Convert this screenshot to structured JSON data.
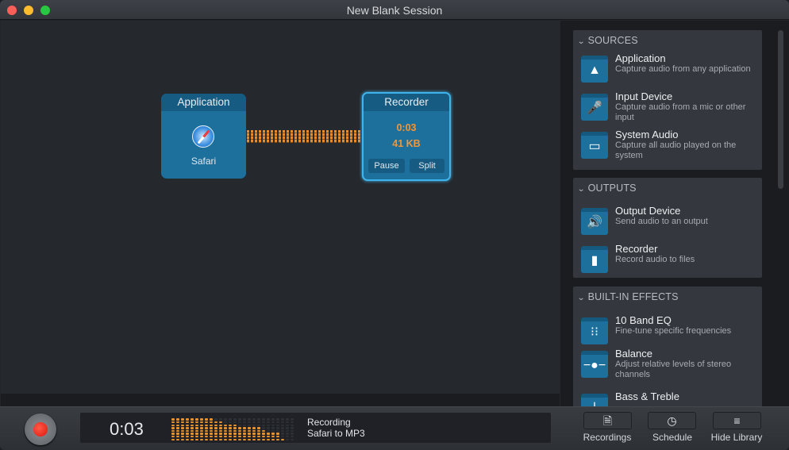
{
  "window": {
    "title": "New Blank Session",
    "controls": [
      "close",
      "minimize",
      "maximize"
    ]
  },
  "canvas": {
    "application_block": {
      "header": "Application",
      "icon": "safari-compass-icon",
      "label": "Safari"
    },
    "recorder_block": {
      "header": "Recorder",
      "time": "0:03",
      "size": "41 KB",
      "pause_label": "Pause",
      "split_label": "Split",
      "selected": true
    },
    "accent_color": "#f0973a"
  },
  "library": {
    "sections": [
      {
        "title": "SOURCES",
        "items": [
          {
            "title": "Application",
            "description": "Capture audio from any application",
            "icon": "app-store-icon"
          },
          {
            "title": "Input Device",
            "description": "Capture audio from a mic or other input",
            "icon": "microphone-icon"
          },
          {
            "title": "System Audio",
            "description": "Capture all audio played on the system",
            "icon": "monitor-icon"
          }
        ]
      },
      {
        "title": "OUTPUTS",
        "items": [
          {
            "title": "Output Device",
            "description": "Send audio to an output",
            "icon": "speaker-icon"
          },
          {
            "title": "Recorder",
            "description": "Record audio to files",
            "icon": "document-icon"
          }
        ]
      },
      {
        "title": "BUILT-IN EFFECTS",
        "items": [
          {
            "title": "10 Band EQ",
            "description": "Fine-tune specific frequencies",
            "icon": "equalizer-icon"
          },
          {
            "title": "Balance",
            "description": "Adjust relative levels of stereo channels",
            "icon": "balance-slider-icon"
          },
          {
            "title": "Bass & Treble",
            "description": "",
            "icon": "bass-treble-icon"
          }
        ]
      }
    ]
  },
  "toolbar": {
    "elapsed": "0:03",
    "status_line1": "Recording",
    "status_line2": "Safari to MP3",
    "meter_levels": [
      8,
      8,
      8,
      8,
      8,
      8,
      8,
      8,
      8,
      7,
      7,
      6,
      6,
      6,
      5,
      5,
      5,
      5,
      5,
      4,
      3,
      3,
      3,
      1,
      0,
      0
    ],
    "meter_max": 8,
    "buttons": [
      {
        "label": "Recordings",
        "icon": "recordings-icon"
      },
      {
        "label": "Schedule",
        "icon": "clock-icon"
      },
      {
        "label": "Hide Library",
        "icon": "list-icon"
      }
    ]
  }
}
